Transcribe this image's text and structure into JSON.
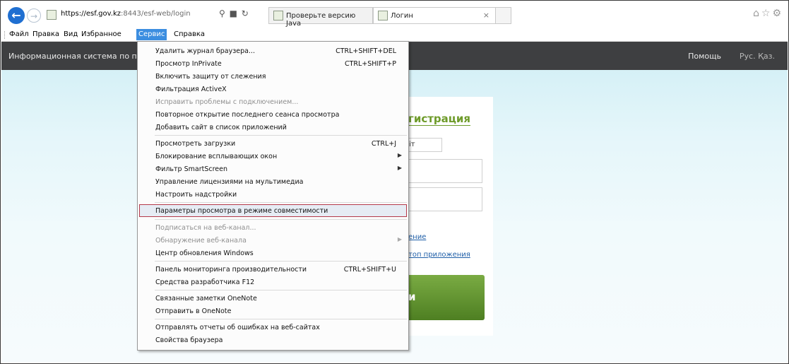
{
  "browser": {
    "url_domain": "https://esf.gov.kz",
    "url_rest": ":8443/esf-web/login",
    "tabs": [
      {
        "label": "Проверьте версию Java"
      },
      {
        "label": "Логин"
      }
    ]
  },
  "menubar": {
    "items": [
      "Файл",
      "Правка",
      "Вид",
      "Избранное",
      "Сервис",
      "Справка"
    ],
    "active": "Сервис"
  },
  "site": {
    "system_name": "Информационная система по прие",
    "help": "Помощь",
    "languages": "Рус.  Қаз."
  },
  "login": {
    "title": "гистрация",
    "box_text": "іт",
    "link1": "ение",
    "link2": "топ приложения",
    "button": "и"
  },
  "tools_menu": {
    "items": [
      {
        "label": "Удалить журнал браузера...",
        "shortcut": "CTRL+SHIFT+DEL"
      },
      {
        "label": "Просмотр InPrivate",
        "shortcut": "CTRL+SHIFT+P"
      },
      {
        "label": "Включить защиту от слежения"
      },
      {
        "label": "Фильтрация ActiveX"
      },
      {
        "label": "Исправить проблемы с подключением...",
        "disabled": true
      },
      {
        "label": "Повторное открытие последнего сеанса просмотра"
      },
      {
        "label": "Добавить сайт в список приложений"
      },
      {
        "label": "Просмотреть загрузки",
        "shortcut": "CTRL+J"
      },
      {
        "label": "Блокирование всплывающих окон",
        "submenu": true
      },
      {
        "label": "Фильтр SmartScreen",
        "submenu": true
      },
      {
        "label": "Управление лицензиями на мультимедиа"
      },
      {
        "label": "Настроить надстройки"
      },
      {
        "label": "Параметры просмотра в режиме совместимости",
        "highlighted": true
      },
      {
        "label": "Подписаться на веб-канал...",
        "disabled": true
      },
      {
        "label": "Обнаружение веб-канала",
        "disabled": true,
        "submenu": true
      },
      {
        "label": "Центр обновления Windows"
      },
      {
        "label": "Панель мониторинга производительности",
        "shortcut": "CTRL+SHIFT+U"
      },
      {
        "label": "Средства разработчика F12"
      },
      {
        "label": "Связанные заметки OneNote"
      },
      {
        "label": "Отправить в OneNote"
      },
      {
        "label": "Отправлять отчеты об ошибках на веб-сайтах"
      },
      {
        "label": "Свойства браузера"
      }
    ]
  },
  "colors": {
    "accent": "#3c8ee0",
    "nav_bg": "#3e3f41",
    "login_green": "#6e9b2a",
    "highlight_border": "#b4394a"
  }
}
